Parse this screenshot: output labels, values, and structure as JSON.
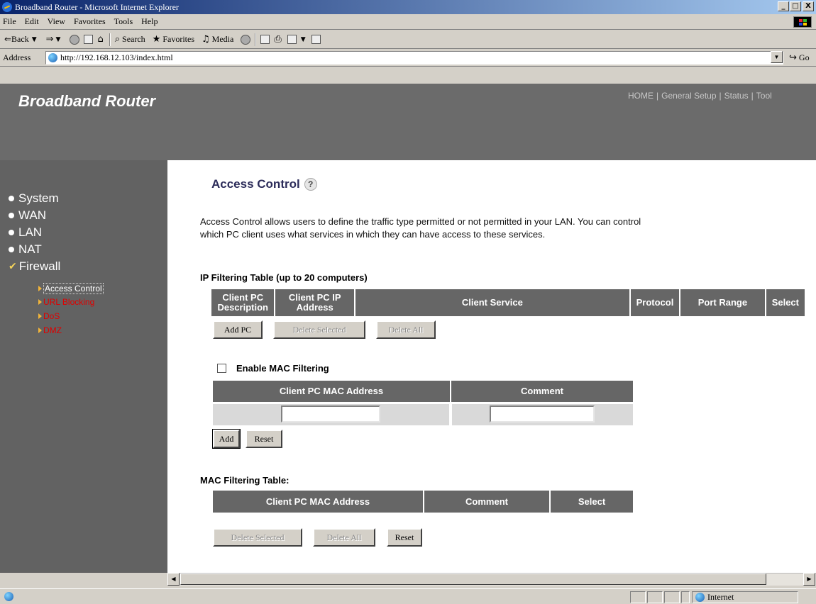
{
  "window": {
    "title": "Broadband Router - Microsoft Internet Explorer",
    "controls": [
      "_",
      "□",
      "X"
    ]
  },
  "menubar": {
    "items": [
      {
        "label": "File"
      },
      {
        "label": "Edit"
      },
      {
        "label": "View"
      },
      {
        "label": "Favorites"
      },
      {
        "label": "Tools"
      },
      {
        "label": "Help"
      }
    ]
  },
  "toolbar": {
    "back": "⇐Back",
    "search": "Search",
    "favorites": "Favorites",
    "media": "Media"
  },
  "addressbar": {
    "label": "Address",
    "url": "http://192.168.12.103/index.html",
    "go": "Go"
  },
  "header": {
    "brand": "Broadband Router",
    "nav": [
      "HOME",
      "General Setup",
      "Status",
      "Tool"
    ],
    "separator": "|"
  },
  "sidebar": {
    "items": [
      {
        "label": "System"
      },
      {
        "label": "WAN"
      },
      {
        "label": "LAN"
      },
      {
        "label": "NAT"
      },
      {
        "label": "Firewall"
      }
    ],
    "subitems": [
      {
        "label": "Access Control"
      },
      {
        "label": "URL Blocking"
      },
      {
        "label": "DoS"
      },
      {
        "label": "DMZ"
      }
    ]
  },
  "main": {
    "title": "Access Control",
    "help_glyph": "?",
    "intro_line1": "Access Control allows users to define the traffic type permitted or not permitted in your LAN. You can control",
    "intro_line2": "which PC client uses what services in which they can have access to these services.",
    "ip_table": {
      "title": "IP Filtering Table (up to 20 computers)",
      "headers": [
        {
          "line1": "Client PC",
          "line2": "Description"
        },
        {
          "line1": "Client PC IP",
          "line2": "Address"
        },
        {
          "line1": "Client Service",
          "line2": ""
        },
        {
          "line1": "Protocol",
          "line2": ""
        },
        {
          "line1": "Port Range",
          "line2": ""
        },
        {
          "line1": "Select",
          "line2": ""
        }
      ],
      "buttons": {
        "add": "Add PC",
        "delete_selected": "Delete Selected",
        "delete_all": "Delete All"
      }
    },
    "mac_filter": {
      "enable_label": "Enable MAC Filtering",
      "enabled": false,
      "headers": [
        "Client PC MAC Address",
        "Comment"
      ],
      "mac_value": "",
      "comment_value": "",
      "buttons": {
        "add": "Add",
        "reset": "Reset"
      }
    },
    "mac_table": {
      "title": "MAC Filtering Table:",
      "headers": [
        "Client PC MAC Address",
        "Comment",
        "Select"
      ],
      "buttons": {
        "delete_selected": "Delete Selected",
        "delete_all": "Delete All",
        "reset": "Reset"
      }
    }
  },
  "statusbar": {
    "zone": "Internet"
  }
}
